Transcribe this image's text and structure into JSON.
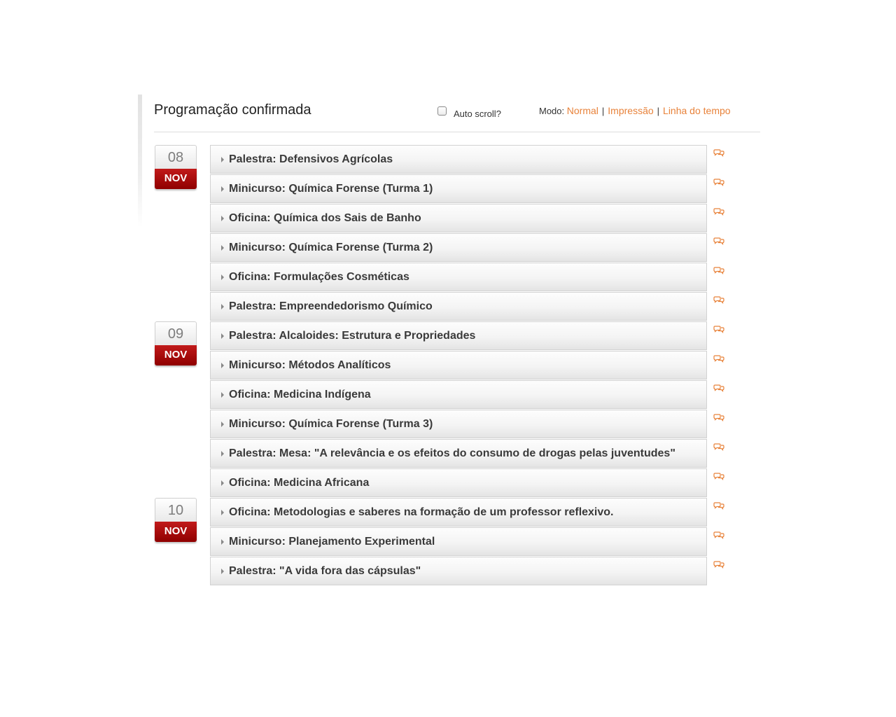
{
  "header": {
    "title": "Programação confirmada",
    "autoscroll_label": "Auto scroll?",
    "mode_label": "Modo:",
    "modes": [
      "Normal",
      "Impressão",
      "Linha do tempo"
    ],
    "mode_separator": "|"
  },
  "colors": {
    "accent": "#e8823a",
    "month_badge": "#b00000"
  },
  "dates": [
    {
      "day": "08",
      "month": "NOV"
    },
    {
      "day": "09",
      "month": "NOV"
    },
    {
      "day": "10",
      "month": "NOV"
    }
  ],
  "events": [
    {
      "title": "Palestra: Defensivos Agrícolas"
    },
    {
      "title": "Minicurso: Química Forense (Turma 1)"
    },
    {
      "title": "Oficina: Química dos Sais de Banho"
    },
    {
      "title": "Minicurso: Química Forense (Turma 2)"
    },
    {
      "title": "Oficina: Formulações Cosméticas"
    },
    {
      "title": "Palestra: Empreendedorismo Químico"
    },
    {
      "title": "Palestra: Alcaloides: Estrutura e Propriedades"
    },
    {
      "title": "Minicurso: Métodos Analíticos"
    },
    {
      "title": "Oficina: Medicina Indígena"
    },
    {
      "title": "Minicurso: Química Forense (Turma 3)"
    },
    {
      "title": "Palestra: Mesa: \"A relevância e os efeitos do consumo de drogas pelas juventudes\""
    },
    {
      "title": "Oficina: Medicina Africana"
    },
    {
      "title": "Oficina: Metodologias e saberes na formação de um professor reflexivo."
    },
    {
      "title": "Minicurso: Planejamento Experimental"
    },
    {
      "title": "Palestra: \"A vida fora das cápsulas\""
    }
  ],
  "icons": {
    "comment": "comment-bubbles-icon",
    "expand": "triangle-right-icon"
  }
}
